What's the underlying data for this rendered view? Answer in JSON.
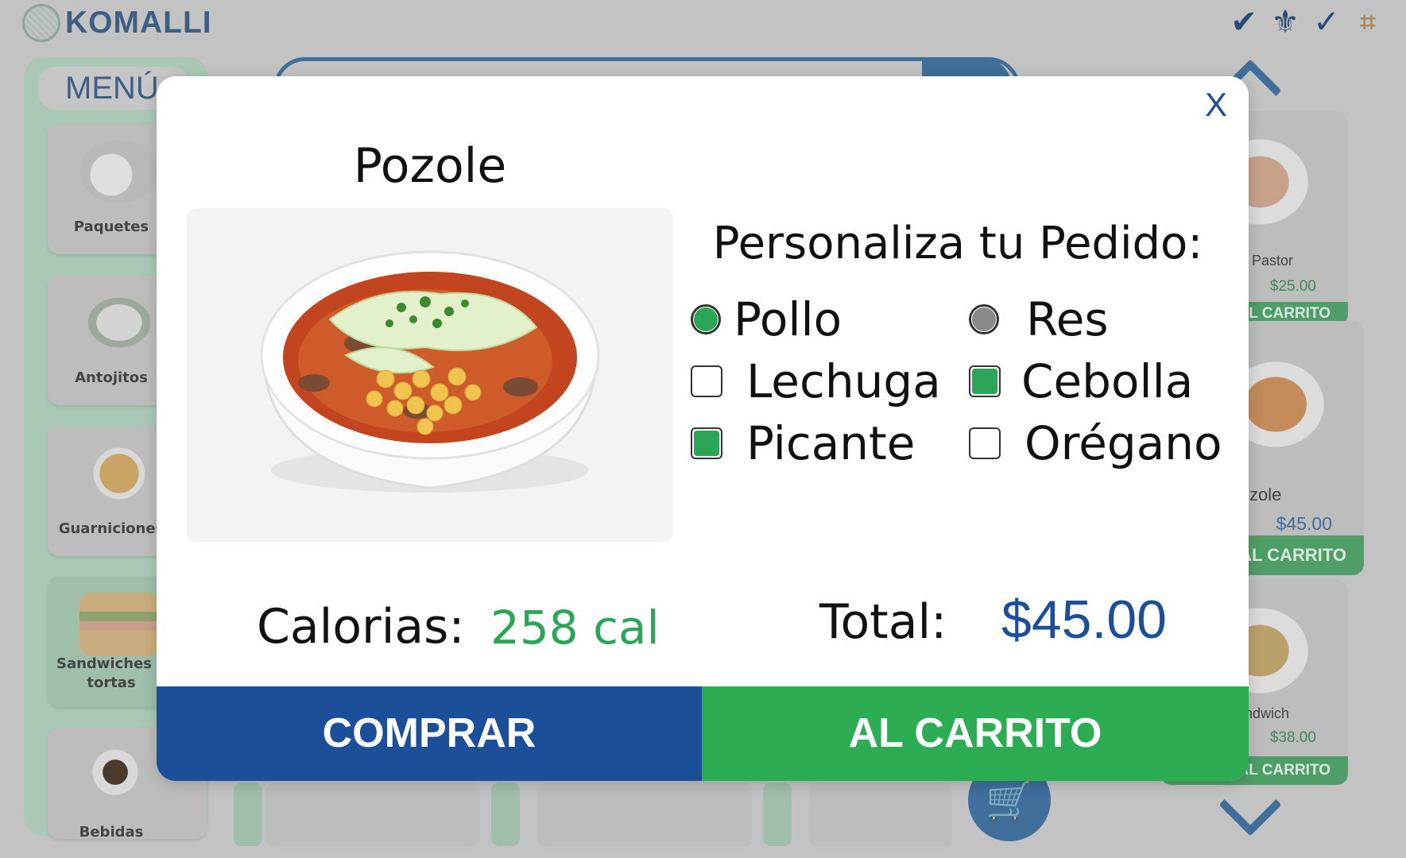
{
  "app": {
    "brand": "KOMALLI"
  },
  "top_icons": [
    "v-check-icon",
    "fleur-icon",
    "v-check-outline-icon",
    "circuit-icon"
  ],
  "sidebar": {
    "menu_label": "MENÚ",
    "items": [
      {
        "label": "Paquetes",
        "icon": "breakfast-icon"
      },
      {
        "label": "Antojitos",
        "icon": "enchiladas-icon"
      },
      {
        "label": "Guarniciones",
        "icon": "soup-icon"
      },
      {
        "label": "Sandwiches y tortas",
        "icon": "sandwich-icon",
        "active": true
      },
      {
        "label": "Bebidas",
        "icon": "coffee-icon"
      }
    ]
  },
  "product_list": [
    {
      "name": "l Pastor",
      "price": "$25.00",
      "button": "AL CARRITO"
    },
    {
      "name": "zole",
      "price": "$45.00",
      "button": "AL CARRITO"
    },
    {
      "name": "ndwich",
      "price": "$38.00",
      "button": "AL CARRITO"
    }
  ],
  "modal": {
    "close_label": "X",
    "item_title": "Pozole",
    "customize_title": "Personaliza tu Pedido:",
    "options": [
      {
        "label": "Pollo",
        "type": "radio",
        "selected": true
      },
      {
        "label": "Res",
        "type": "radio",
        "selected": false
      },
      {
        "label": "Lechuga",
        "type": "checkbox",
        "checked": false
      },
      {
        "label": "Cebolla",
        "type": "checkbox",
        "checked": true
      },
      {
        "label": "Picante",
        "type": "checkbox",
        "checked": true
      },
      {
        "label": "Orégano",
        "type": "checkbox",
        "checked": false
      }
    ],
    "calories_label": "Calorias:",
    "calories_value": "258 cal",
    "total_label": "Total:",
    "total_value": "$45.00",
    "buy_label": "COMPRAR",
    "cart_label": "AL CARRITO"
  },
  "colors": {
    "primary_blue": "#1b4f9a",
    "accent_green": "#2ca656",
    "radio_off": "#8a8a8a"
  }
}
